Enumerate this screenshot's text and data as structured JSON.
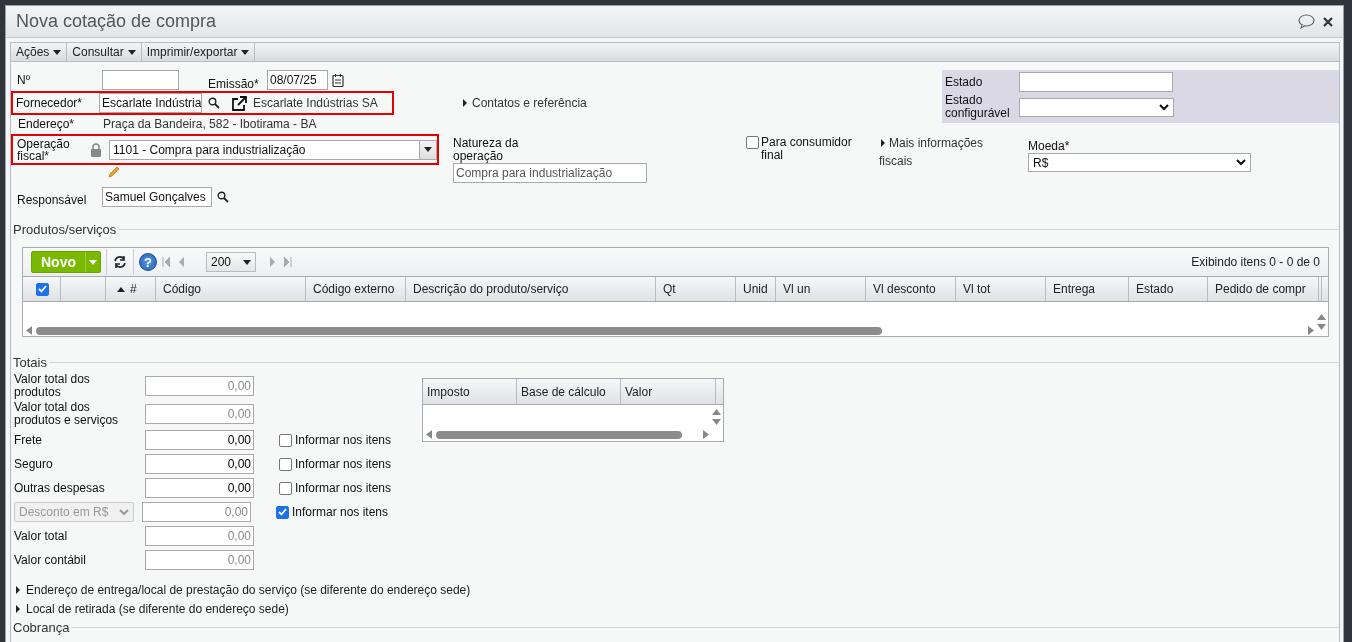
{
  "window": {
    "title": "Nova cotação de compra"
  },
  "menus": [
    {
      "label": "Ações"
    },
    {
      "label": "Consultar"
    },
    {
      "label": "Imprimir/exportar"
    }
  ],
  "number_field": {
    "label": "Nº"
  },
  "issue_date": {
    "label": "Emissão*",
    "value": "08/07/25"
  },
  "supplier": {
    "label": "Fornecedor*",
    "value": "Escarlate Indústria",
    "name": "Escarlate Indústrias SA",
    "highlighted": true
  },
  "contacts": {
    "label": "Contatos e referência",
    "expanded": false
  },
  "address": {
    "label": "Endereço*",
    "value": "Praça da Bandeira, 582 - Ibotirama - BA"
  },
  "fiscal_operation": {
    "label": "Operação fiscal*",
    "value": "1101 - Compra para industrialização",
    "locked": true,
    "highlighted": true
  },
  "operation_nature": {
    "label": "Natureza da operação",
    "value": "Compra para industrialização"
  },
  "final_consumer": {
    "label": "Para consumidor final",
    "checked": false
  },
  "more_fiscal_info": {
    "label": "Mais informações fiscais",
    "expanded": false
  },
  "currency": {
    "label": "Moeda*",
    "value": "R$"
  },
  "responsible": {
    "label": "Responsável",
    "value": "Samuel Gonçalves"
  },
  "status_panel": {
    "status_label": "Estado",
    "configurable_label": "Estado configurável"
  },
  "products": {
    "title": "Produtos/serviços",
    "new_button": "Novo",
    "help_button": "?",
    "page_size": "200",
    "summary": "Exibindo itens 0 - 0 de 0",
    "select_all": true,
    "columns": [
      {
        "label": "#",
        "sorted": true
      },
      {
        "label": "Código",
        "sorted": false
      },
      {
        "label": "Código externo",
        "sorted": false
      },
      {
        "label": "Descrição do produto/serviço",
        "sorted": false
      },
      {
        "label": "Qt",
        "sorted": false
      },
      {
        "label": "Unid",
        "sorted": false
      },
      {
        "label": "Vl un",
        "sorted": false
      },
      {
        "label": "Vl desconto",
        "sorted": false
      },
      {
        "label": "Vl tot",
        "sorted": false
      },
      {
        "label": "Entrega",
        "sorted": false
      },
      {
        "label": "Estado",
        "sorted": false
      },
      {
        "label": "Pedido de compr",
        "sorted": false
      }
    ]
  },
  "totals": {
    "title": "Totais",
    "rows": [
      {
        "kind": "field",
        "label": "Valor total dos produtos",
        "value": "0,00",
        "editable": false
      },
      {
        "kind": "field",
        "label": "Valor total dos produtos e serviços",
        "value": "0,00",
        "editable": false
      },
      {
        "kind": "field",
        "label": "Frete",
        "value": "0,00",
        "editable": true,
        "item_option": {
          "label": "Informar nos itens",
          "checked": false
        }
      },
      {
        "kind": "field",
        "label": "Seguro",
        "value": "0,00",
        "editable": true,
        "item_option": {
          "label": "Informar nos itens",
          "checked": false
        }
      },
      {
        "kind": "field",
        "label": "Outras despesas",
        "value": "0,00",
        "editable": true,
        "item_option": {
          "label": "Informar nos itens",
          "checked": false
        }
      },
      {
        "kind": "select",
        "label": "Desconto em R$",
        "value": "0,00",
        "editable": false,
        "item_option": {
          "label": "Informar nos itens",
          "checked": true
        }
      },
      {
        "kind": "field",
        "label": "Valor total",
        "value": "0,00",
        "editable": false
      },
      {
        "kind": "field",
        "label": "Valor contábil",
        "value": "0,00",
        "editable": false
      }
    ]
  },
  "tax_table": {
    "columns": [
      "Imposto",
      "Base de cálculo",
      "Valor"
    ]
  },
  "sections": [
    {
      "label": "Endereço de entrega/local de prestação do serviço (se diferente do endereço sede)",
      "expanded": false
    },
    {
      "label": "Local de retirada (se diferente do endereço sede)",
      "expanded": false
    }
  ],
  "billing": {
    "title": "Cobrança"
  }
}
